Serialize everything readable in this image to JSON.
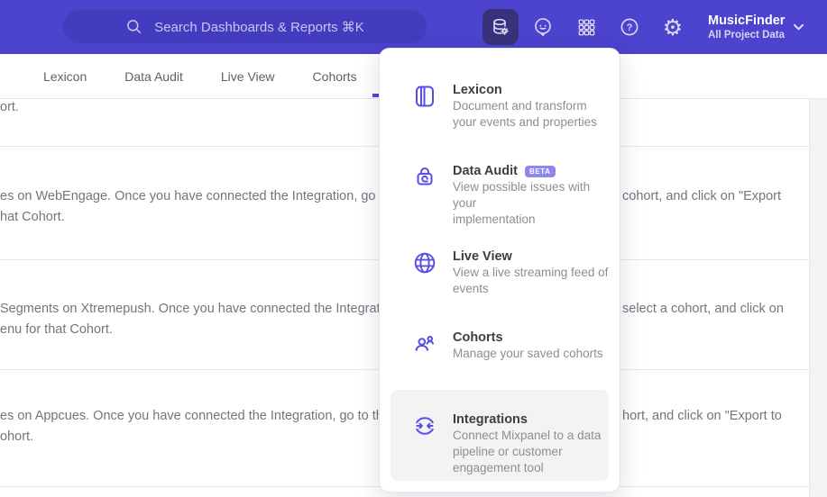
{
  "colors": {
    "header_bg": "#4C43CE",
    "accent": "#4F44E0",
    "active_icon_bg": "#38317C",
    "badge_bg": "#8F88EC",
    "hover_bg": "#F3F3F4"
  },
  "header": {
    "search": {
      "placeholder": "Search Dashboards & Reports ⌘K"
    },
    "project": {
      "name": "MusicFinder",
      "scope": "All Project Data"
    },
    "icons": [
      "search",
      "data-management",
      "feedback-smiley",
      "apps-grid",
      "help",
      "settings-gear",
      "chevron-down"
    ]
  },
  "tabs": {
    "items": [
      {
        "label": "Lexicon"
      },
      {
        "label": "Data Audit"
      },
      {
        "label": "Live View"
      },
      {
        "label": "Cohorts"
      }
    ]
  },
  "menu": {
    "items": [
      {
        "title": "Lexicon",
        "icon": "book",
        "description": "Document and transform\nyour events and properties"
      },
      {
        "title": "Data Audit",
        "icon": "audit-lock",
        "badge": "BETA",
        "description": "View possible issues with your\nimplementation"
      },
      {
        "title": "Live View",
        "icon": "globe",
        "description": "View a live streaming feed of\nevents"
      },
      {
        "title": "Cohorts",
        "icon": "people",
        "description": "Manage your saved cohorts"
      },
      {
        "title": "Integrations",
        "icon": "sync-arrows",
        "highlighted": true,
        "description": "Connect Mixpanel to a data\npipeline or customer\nengagement tool"
      }
    ]
  },
  "background_rows": [
    {
      "left": [
        "ort."
      ]
    },
    {
      "left": [
        "es on WebEngage. Once you have connected the Integration, go to the",
        "hat Cohort."
      ],
      "right": "cohort, and click on \"Export"
    },
    {
      "left": [
        "Segments on Xtremepush. Once you have connected the Integration,",
        "enu for that Cohort."
      ],
      "right": "select a cohort, and click on"
    },
    {
      "left": [
        "es on Appcues. Once you have connected the Integration, go to the M",
        "ohort."
      ],
      "right": "hort, and click on \"Export to"
    }
  ]
}
